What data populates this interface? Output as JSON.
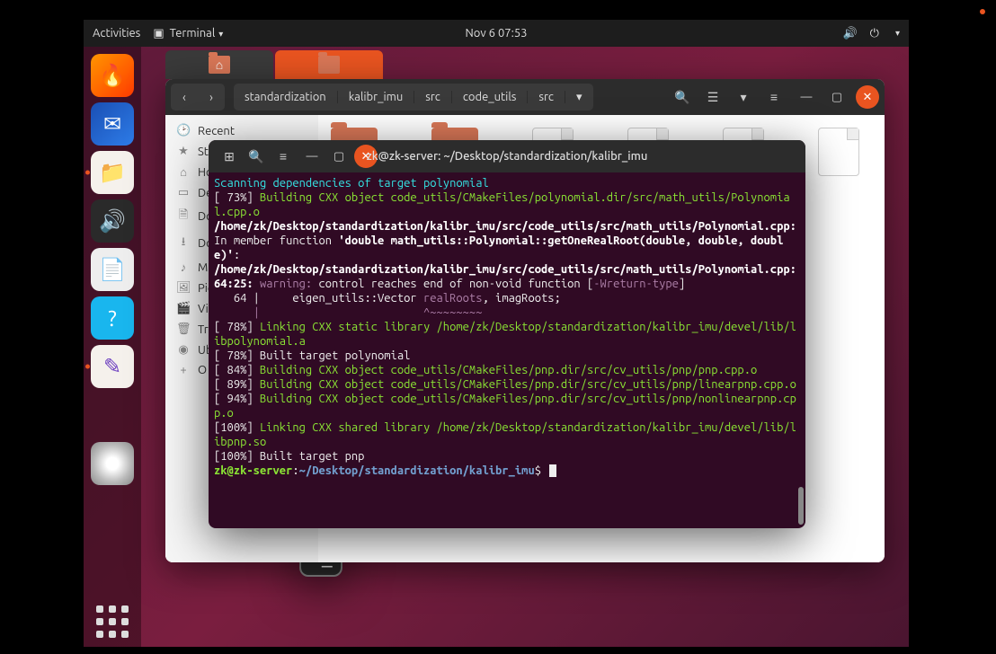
{
  "topbar": {
    "activities": "Activities",
    "app": "Terminal",
    "datetime": "Nov 6  07:53"
  },
  "nautilus": {
    "breadcrumbs": [
      "standardization",
      "kalibr_imu",
      "src",
      "code_utils",
      "src"
    ],
    "sidebar": [
      "Recent",
      "Sta",
      "Ho",
      "De",
      "Do",
      "Do",
      "Mu",
      "Pic",
      "Vid",
      "Tr",
      "Ub"
    ]
  },
  "terminal": {
    "title": "zk@zk-server: ~/Desktop/standardization/kalibr_imu",
    "l1": "Scanning dependencies of target polynomial",
    "l2a": "[ 73%] ",
    "l2b": "Building CXX object code_utils/CMakeFiles/polynomial.dir/src/math_utils/Polynomial.cpp.o",
    "l3": "/home/zk/Desktop/standardization/kalibr_imu/src/code_utils/src/math_utils/Polynomial.cpp:",
    "l3b": " In member function ",
    "l3c": "'double math_utils::Polynomial::getOneRealRoot(double, double, double)'",
    "l3d": ":",
    "l4": "/home/zk/Desktop/standardization/kalibr_imu/src/code_utils/src/math_utils/Polynomial.cpp:64:25: ",
    "l4w": "warning: ",
    "l4t": "control reaches end of non-void function [",
    "l4f": "-Wreturn-type",
    "l4e": "]",
    "l5": "   64 |     eigen_utils::Vector ",
    "l5r": "realRoots",
    "l5t": ", imagRoots;",
    "l5u": "      |                         ^~~~~~~~~",
    "l6a": "[ 78%] ",
    "l6b": "Linking CXX static library /home/zk/Desktop/standardization/kalibr_imu/devel/lib/libpolynomial.a",
    "l7": "[ 78%] Built target polynomial",
    "l8a": "[ 84%] ",
    "l8b": "Building CXX object code_utils/CMakeFiles/pnp.dir/src/cv_utils/pnp/pnp.cpp.o",
    "l9a": "[ 89%] ",
    "l9b": "Building CXX object code_utils/CMakeFiles/pnp.dir/src/cv_utils/pnp/linearpnp.cpp.o",
    "l10a": "[ 94%] ",
    "l10b": "Building CXX object code_utils/CMakeFiles/pnp.dir/src/cv_utils/pnp/nonlinearpnp.cpp.o",
    "l11a": "[100%] ",
    "l11b": "Linking CXX shared library /home/zk/Desktop/standardization/kalibr_imu/devel/lib/libpnp.so",
    "l12": "[100%] Built target pnp",
    "p_user": "zk@zk-server",
    "p_sep": ":",
    "p_path": "~/Desktop/standardization/kalibr_imu",
    "p_end": "$ "
  }
}
